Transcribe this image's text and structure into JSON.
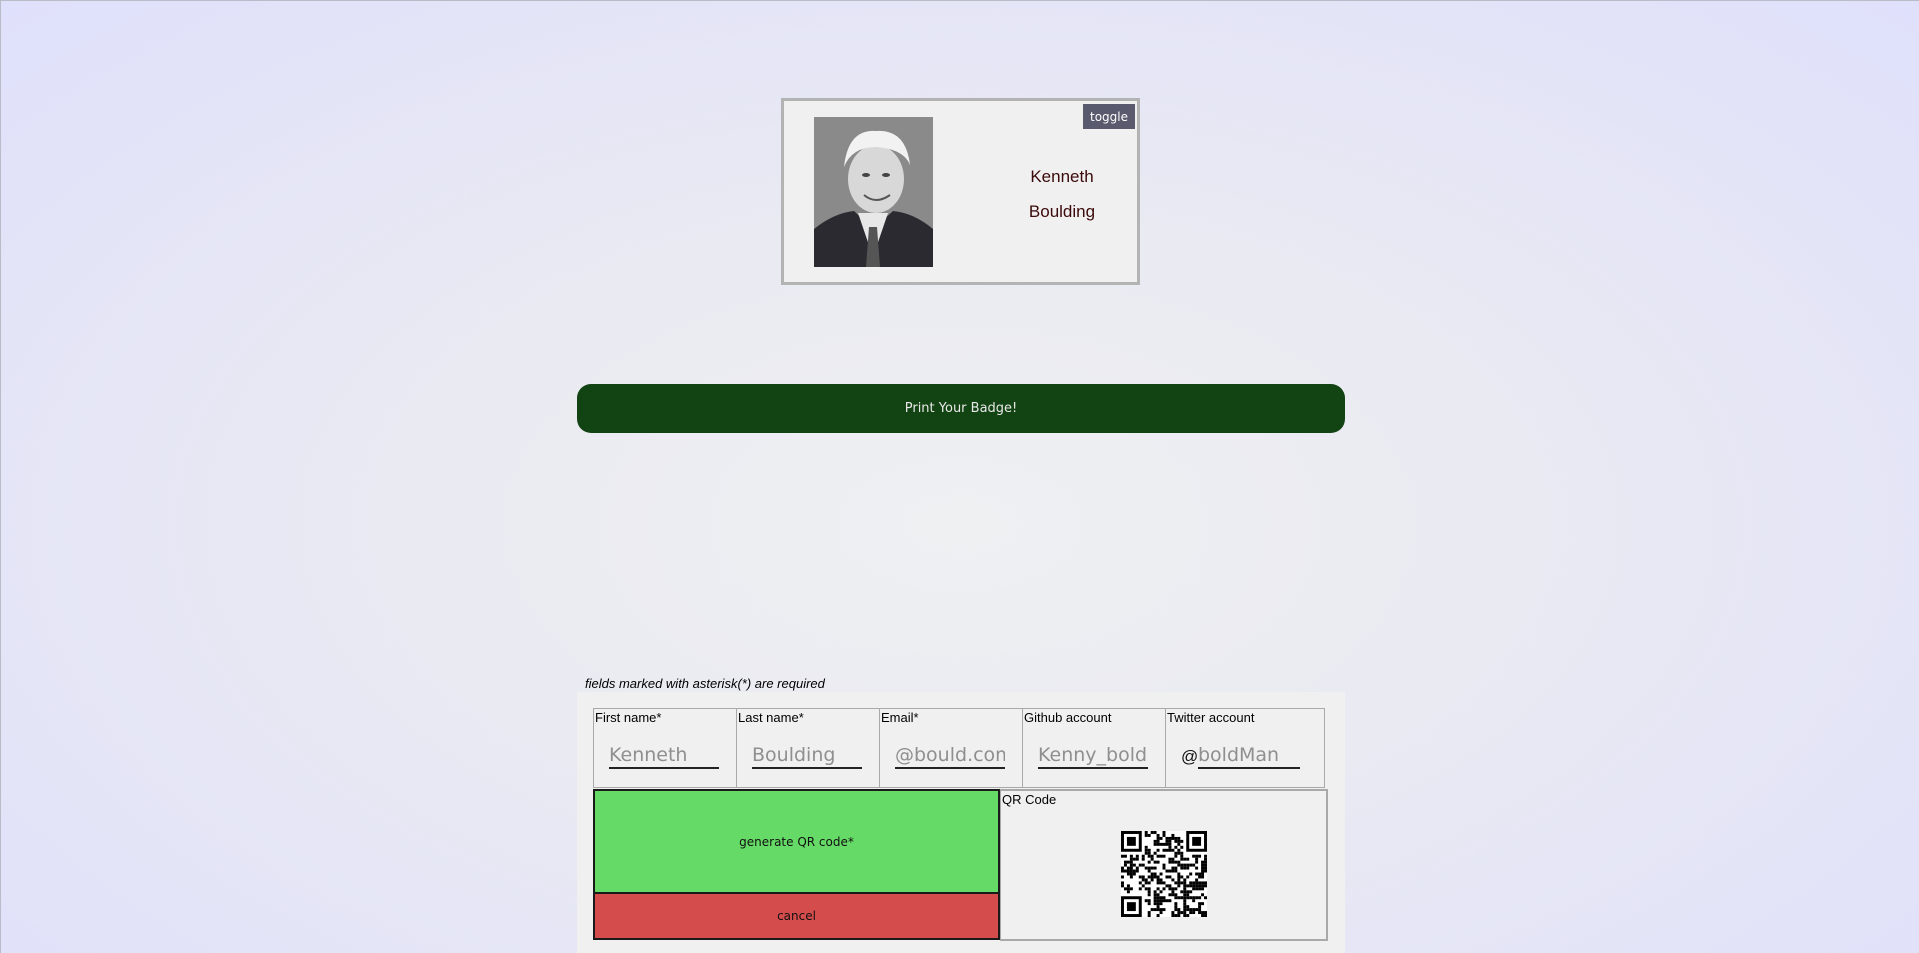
{
  "badge": {
    "first_name": "Kenneth",
    "last_name": "Boulding",
    "toggle_label": "toggle",
    "photo_icon": "portrait-photo"
  },
  "print_button_label": "Print Your Badge!",
  "form": {
    "required_note": "fields marked with asterisk(*) are required",
    "fields": [
      {
        "label": "First name*",
        "placeholder": "Kenneth",
        "value": ""
      },
      {
        "label": "Last name*",
        "placeholder": "Boulding",
        "value": ""
      },
      {
        "label": "Email*",
        "placeholder": "@bould.com",
        "value": ""
      },
      {
        "label": "Github account",
        "placeholder": "Kenny_bold",
        "value": ""
      },
      {
        "label": "Twitter account",
        "prefix": "@",
        "placeholder": "boldMan",
        "value": ""
      }
    ],
    "generate_label": "generate QR code*",
    "cancel_label": "cancel",
    "qr_label": "QR Code"
  },
  "colors": {
    "print_button": "#124312",
    "generate_button": "#66da66",
    "cancel_button": "#d54c4c",
    "toggle_button": "#5a5a6e",
    "badge_name_text": "#3b0a0a"
  }
}
